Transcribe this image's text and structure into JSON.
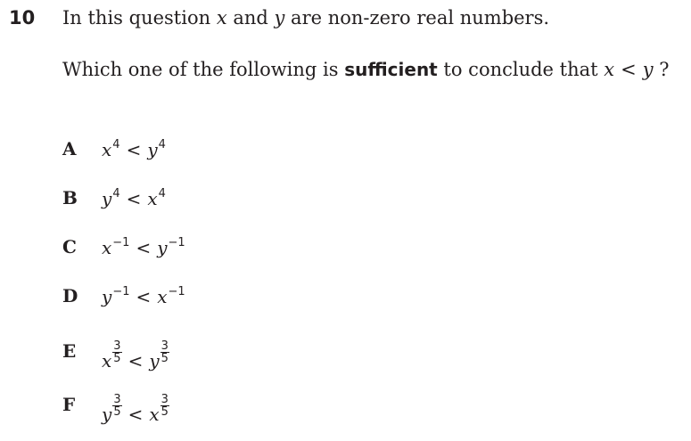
{
  "question": {
    "number": "10",
    "line1": {
      "pre": "In this question ",
      "var1": "x",
      "mid": " and ",
      "var2": "y",
      "post": " are non-zero real numbers."
    },
    "line2": {
      "pre": "Which one of the following is ",
      "bold": "sufficient",
      "mid": " to conclude that ",
      "var1": "x",
      "lt": "<",
      "var2": "y",
      "post": " ?"
    }
  },
  "options": [
    {
      "letter": "A",
      "lhs_base": "x",
      "lhs_exp": "4",
      "op": "<",
      "rhs_base": "y",
      "rhs_exp": "4"
    },
    {
      "letter": "B",
      "lhs_base": "y",
      "lhs_exp": "4",
      "op": "<",
      "rhs_base": "x",
      "rhs_exp": "4"
    },
    {
      "letter": "C",
      "lhs_base": "x",
      "lhs_exp": "−1",
      "op": "<",
      "rhs_base": "y",
      "rhs_exp": "−1"
    },
    {
      "letter": "D",
      "lhs_base": "y",
      "lhs_exp": "−1",
      "op": "<",
      "rhs_base": "x",
      "rhs_exp": "−1"
    },
    {
      "letter": "E",
      "lhs_base": "x",
      "lhs_num": "3",
      "lhs_den": "5",
      "op": "<",
      "rhs_base": "y",
      "rhs_num": "3",
      "rhs_den": "5"
    },
    {
      "letter": "F",
      "lhs_base": "y",
      "lhs_num": "3",
      "lhs_den": "5",
      "op": "<",
      "rhs_base": "x",
      "rhs_num": "3",
      "rhs_den": "5"
    }
  ]
}
